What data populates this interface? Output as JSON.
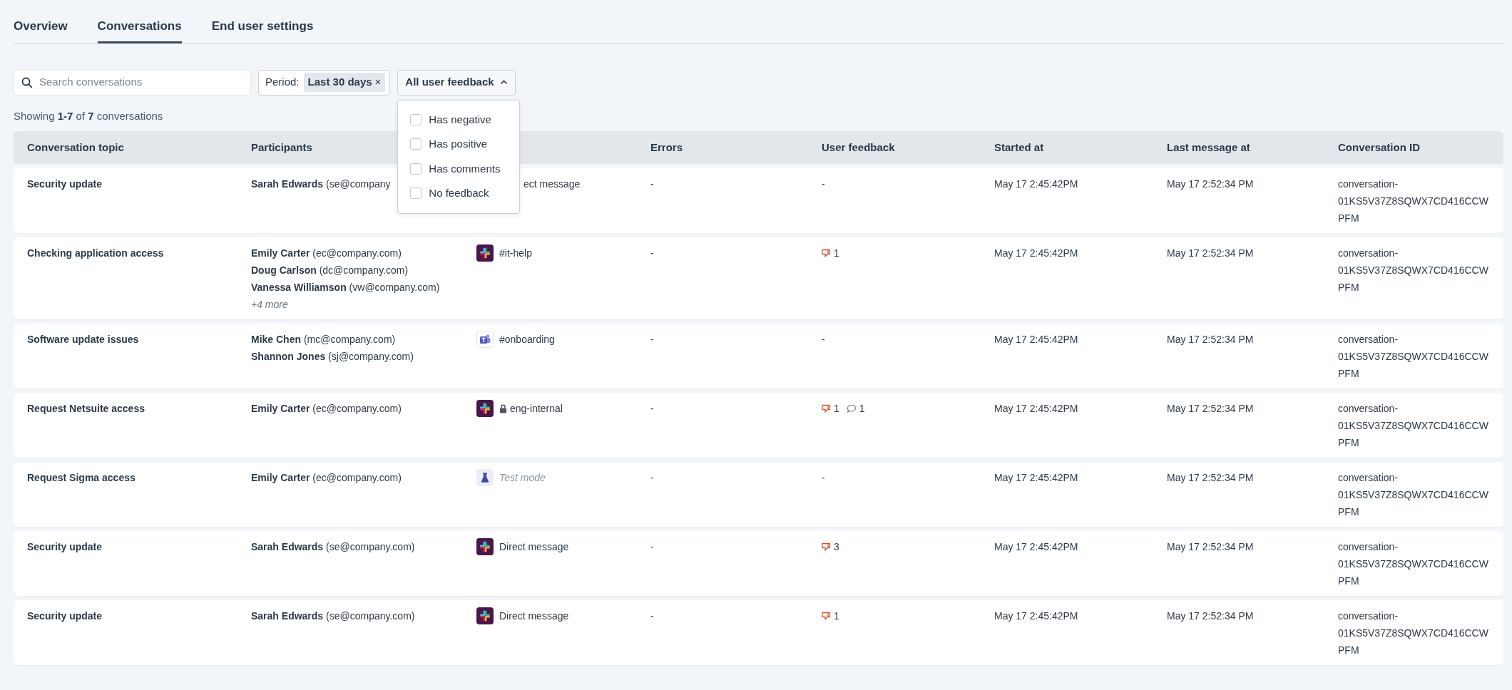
{
  "tabs": [
    {
      "label": "Overview",
      "selected": false
    },
    {
      "label": "Conversations",
      "selected": true
    },
    {
      "label": "End user settings",
      "selected": false
    }
  ],
  "filters": {
    "search": {
      "placeholder": "Search conversations"
    },
    "period": {
      "label": "Period:",
      "value": "Last 30 days",
      "remove": "×"
    },
    "feedback": {
      "label": "All user feedback",
      "expanded": true,
      "options": [
        {
          "label": "Has negative",
          "checked": false
        },
        {
          "label": "Has positive",
          "checked": false
        },
        {
          "label": "Has comments",
          "checked": false
        },
        {
          "label": "No feedback",
          "checked": false
        }
      ]
    }
  },
  "summary": "Showing **1-7** of **7** conversations",
  "table": {
    "columns": {
      "topic": "Conversation topic",
      "participants": "Participants",
      "errors": "Errors",
      "feedback": "User feedback",
      "started": "Started at",
      "last_message": "Last message at",
      "id": "Conversation ID"
    },
    "rows": [
      {
        "topic": "Security update",
        "participants": [
          {
            "name": "Sarah Edwards",
            "email": "(se@company"
          }
        ],
        "channel": {
          "kind": "covered",
          "label": "ect message",
          "private": false
        },
        "errors": "-",
        "feedback_text": "-",
        "started": "May 17 2:45:42PM",
        "last_message": "May 17 2:52:34 PM",
        "id": "conversation-01KS5V37Z8SQWX7CD416CCWPFM"
      },
      {
        "topic": "Checking application access",
        "participants": [
          {
            "name": "Emily Carter",
            "email": "(ec@company.com)"
          },
          {
            "name": "Doug Carlson",
            "email": "(dc@company.com)"
          },
          {
            "name": "Vanessa Williamson",
            "email": "(vw@company.com)"
          }
        ],
        "more": "+4 more",
        "channel": {
          "kind": "slack",
          "label": "#it-help",
          "private": false
        },
        "errors": "-",
        "feedback": [
          {
            "kind": "negative",
            "count": "1"
          }
        ],
        "started": "May 17 2:45:42PM",
        "last_message": "May 17 2:52:34 PM",
        "id": "conversation-01KS5V37Z8SQWX7CD416CCWPFM"
      },
      {
        "topic": "Software update issues",
        "participants": [
          {
            "name": "Mike Chen",
            "email": "(mc@company.com)"
          },
          {
            "name": "Shannon Jones",
            "email": "(sj@company.com)"
          }
        ],
        "channel": {
          "kind": "teams",
          "label": "#onboarding",
          "private": false
        },
        "errors": "-",
        "feedback_text": "-",
        "started": "May 17 2:45:42PM",
        "last_message": "May 17 2:52:34 PM",
        "id": "conversation-01KS5V37Z8SQWX7CD416CCWPFM"
      },
      {
        "topic": "Request Netsuite access",
        "participants": [
          {
            "name": "Emily Carter",
            "email": "(ec@company.com)"
          }
        ],
        "channel": {
          "kind": "slack",
          "label": "eng-internal",
          "private": true
        },
        "errors": "-",
        "feedback": [
          {
            "kind": "negative",
            "count": "1"
          },
          {
            "kind": "comment",
            "count": "1"
          }
        ],
        "started": "May 17 2:45:42PM",
        "last_message": "May 17 2:52:34 PM",
        "id": "conversation-01KS5V37Z8SQWX7CD416CCWPFM"
      },
      {
        "topic": "Request Sigma access",
        "participants": [
          {
            "name": "Emily Carter",
            "email": "(ec@company.com)"
          }
        ],
        "channel": {
          "kind": "test",
          "label": "Test mode",
          "private": false
        },
        "errors": "-",
        "feedback_text": "-",
        "started": "May 17 2:45:42PM",
        "last_message": "May 17 2:52:34 PM",
        "id": "conversation-01KS5V37Z8SQWX7CD416CCWPFM"
      },
      {
        "topic": "Security update",
        "participants": [
          {
            "name": "Sarah Edwards",
            "email": "(se@company.com)"
          }
        ],
        "channel": {
          "kind": "slack",
          "label": "Direct message",
          "private": false
        },
        "errors": "-",
        "feedback": [
          {
            "kind": "negative",
            "count": "3"
          }
        ],
        "started": "May 17 2:45:42PM",
        "last_message": "May 17 2:52:34 PM",
        "id": "conversation-01KS5V37Z8SQWX7CD416CCWPFM"
      },
      {
        "topic": "Security update",
        "participants": [
          {
            "name": "Sarah Edwards",
            "email": "(se@company.com)"
          }
        ],
        "channel": {
          "kind": "slack",
          "label": "Direct message",
          "private": false
        },
        "errors": "-",
        "feedback": [
          {
            "kind": "negative",
            "count": "1"
          }
        ],
        "started": "May 17 2:45:42PM",
        "last_message": "May 17 2:52:34 PM",
        "id": "conversation-01KS5V37Z8SQWX7CD416CCWPFM"
      }
    ]
  }
}
